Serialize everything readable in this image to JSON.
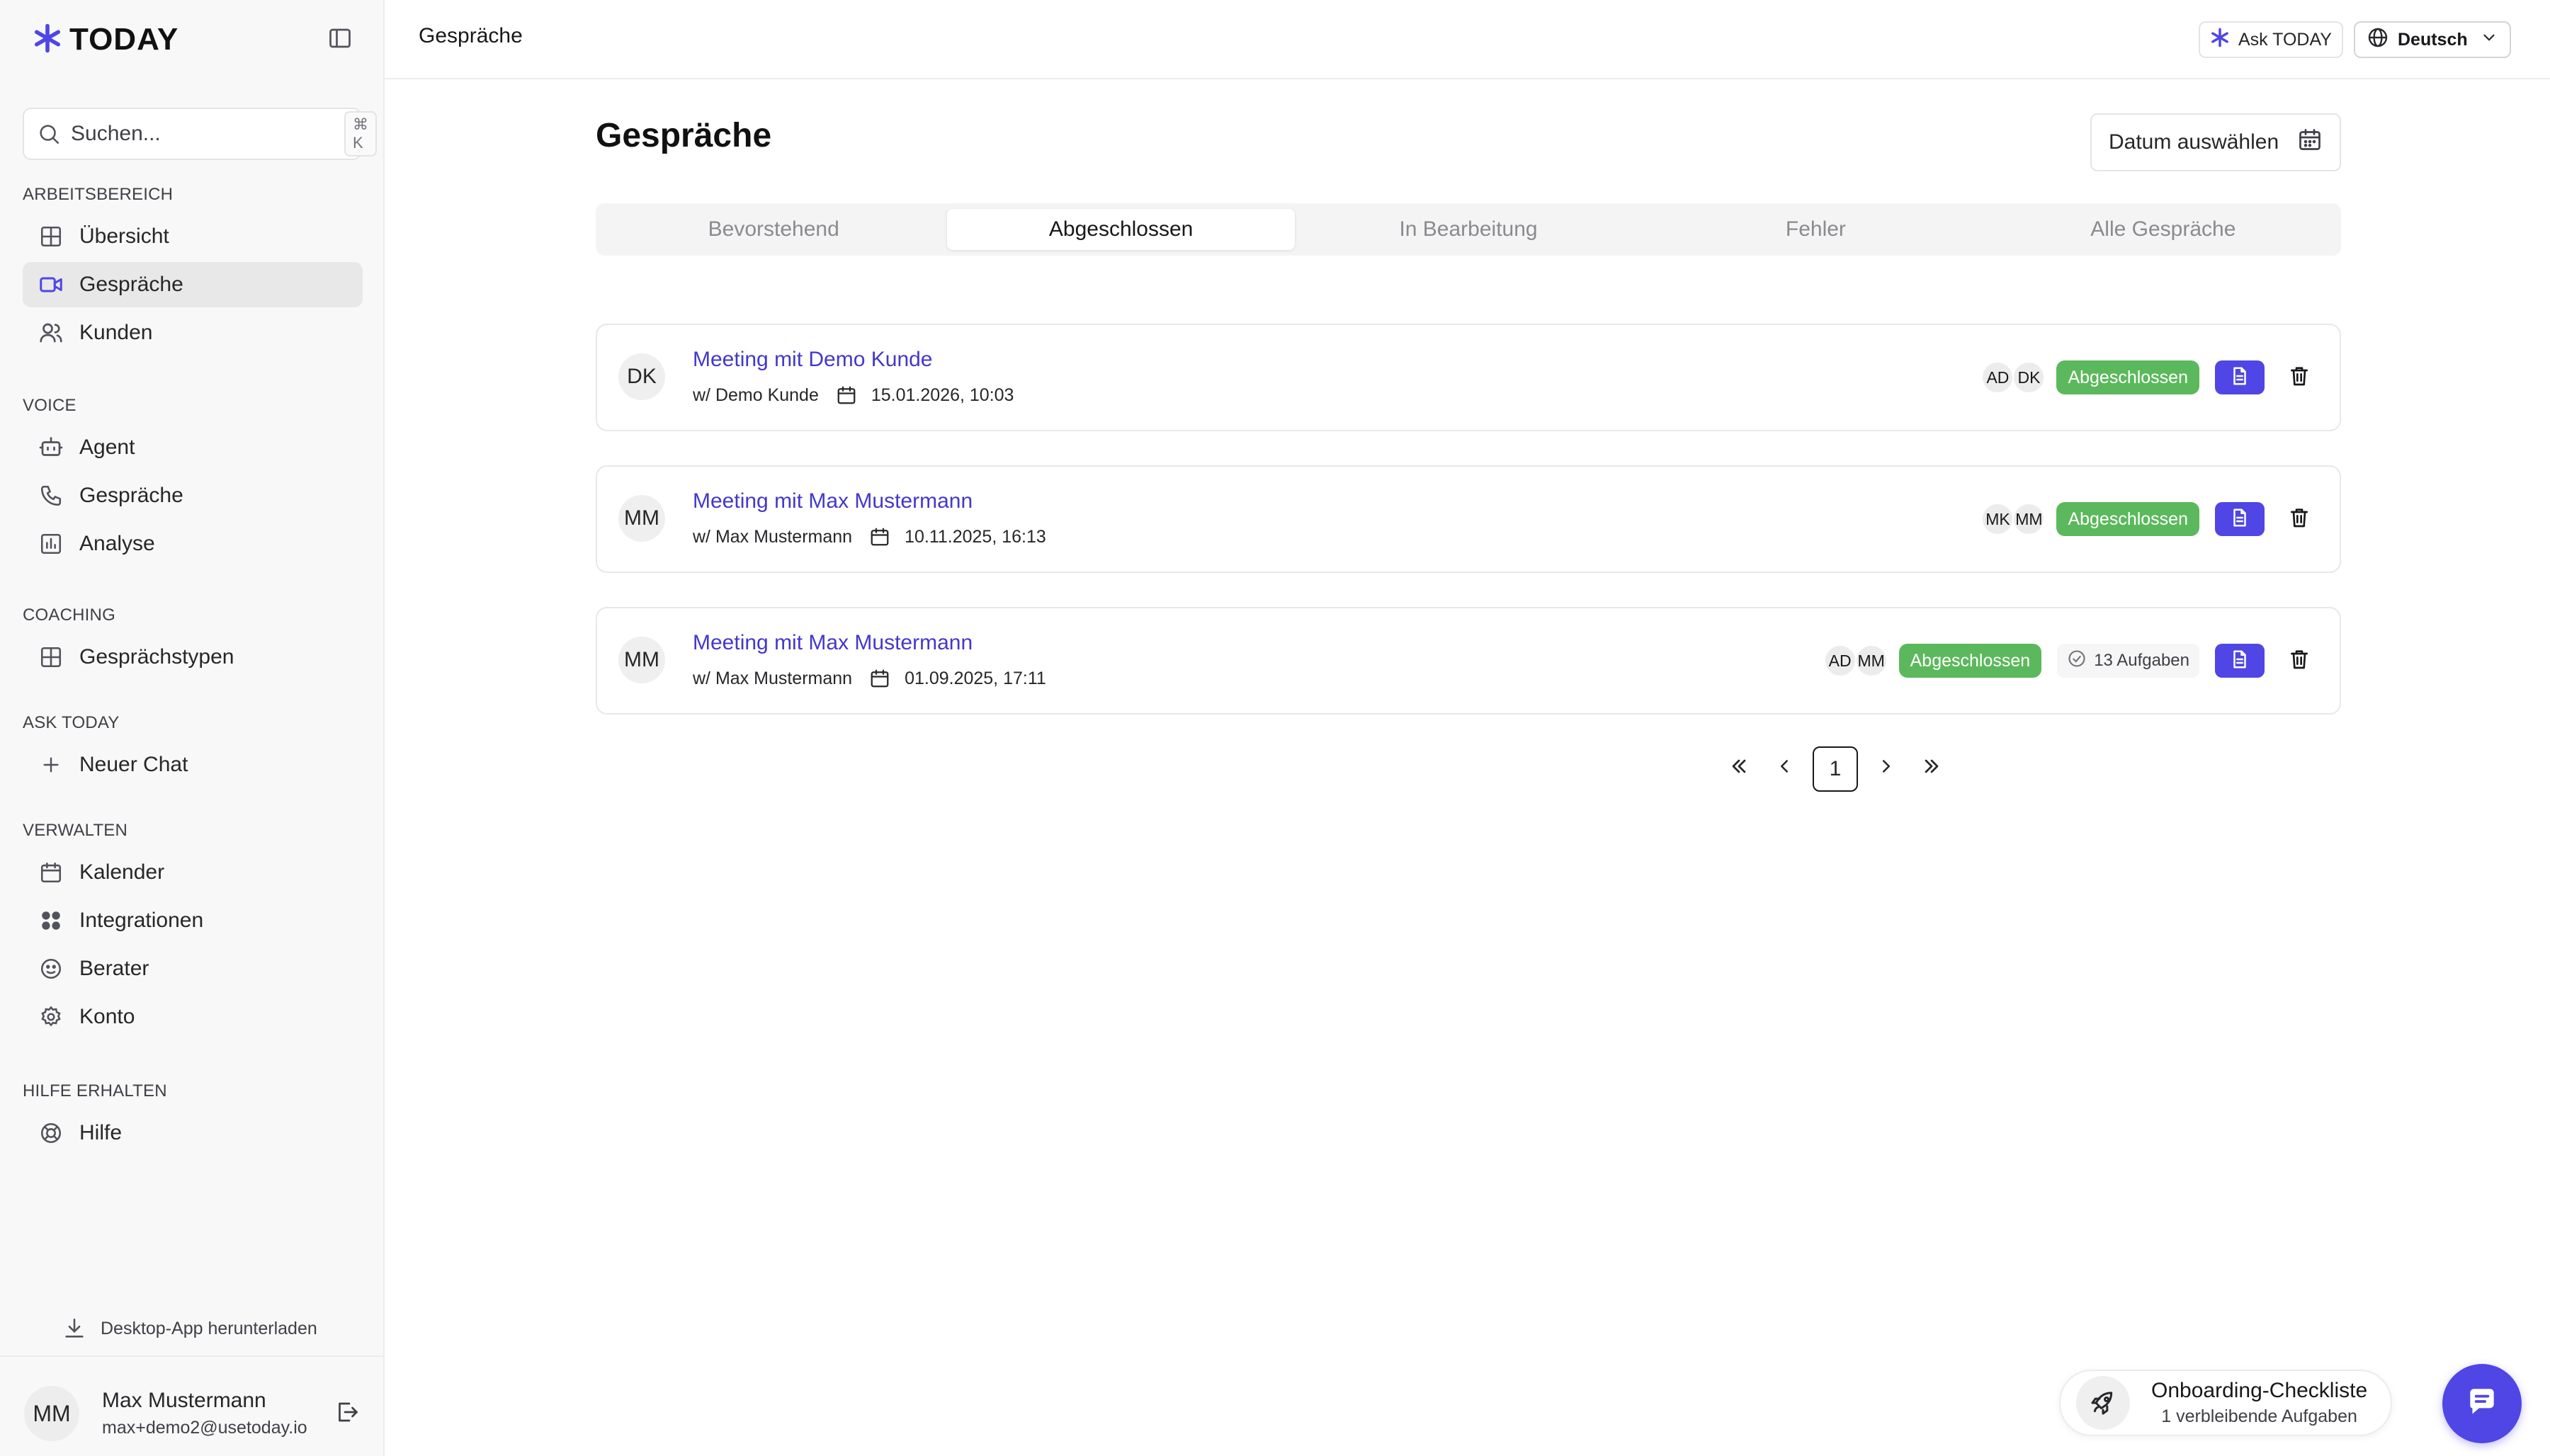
{
  "app": {
    "brand": "TODAY",
    "accent": "#4f46e5"
  },
  "sidebar": {
    "search": {
      "placeholder": "Suchen...",
      "shortcut": "⌘ K"
    },
    "sections": [
      {
        "title": "ARBEITSBEREICH",
        "items": [
          {
            "label": "Übersicht",
            "icon": "grid-icon"
          },
          {
            "label": "Gespräche",
            "icon": "video-icon",
            "active": true
          },
          {
            "label": "Kunden",
            "icon": "users-icon"
          }
        ]
      },
      {
        "title": "VOICE",
        "items": [
          {
            "label": "Agent",
            "icon": "bot-icon"
          },
          {
            "label": "Gespräche",
            "icon": "phone-icon"
          },
          {
            "label": "Analyse",
            "icon": "chart-icon"
          }
        ]
      },
      {
        "title": "COACHING",
        "items": [
          {
            "label": "Gesprächstypen",
            "icon": "grid-icon"
          }
        ]
      },
      {
        "title": "ASK TODAY",
        "items": [
          {
            "label": "Neuer Chat",
            "icon": "plus-icon"
          }
        ]
      },
      {
        "title": "VERWALTEN",
        "items": [
          {
            "label": "Kalender",
            "icon": "calendar-icon"
          },
          {
            "label": "Integrationen",
            "icon": "apps-icon"
          },
          {
            "label": "Berater",
            "icon": "face-icon"
          },
          {
            "label": "Konto",
            "icon": "gear-icon"
          }
        ]
      },
      {
        "title": "HILFE ERHALTEN",
        "items": [
          {
            "label": "Hilfe",
            "icon": "lifebuoy-icon"
          }
        ]
      }
    ],
    "download_label": "Desktop-App herunterladen",
    "user": {
      "initials": "MM",
      "name": "Max Mustermann",
      "email": "max+demo2@usetoday.io"
    }
  },
  "header": {
    "breadcrumb": "Gespräche",
    "ask_label": "Ask TODAY",
    "language": "Deutsch"
  },
  "main": {
    "title": "Gespräche",
    "date_placeholder": "Datum auswählen",
    "tabs": [
      {
        "label": "Bevorstehend"
      },
      {
        "label": "Abgeschlossen",
        "active": true
      },
      {
        "label": "In Bearbeitung"
      },
      {
        "label": "Fehler"
      },
      {
        "label": "Alle Gespräche"
      }
    ],
    "conversations": [
      {
        "initials": "DK",
        "title": "Meeting mit Demo Kunde",
        "with": "w/ Demo Kunde",
        "datetime": "15.01.2026, 10:03",
        "participants": [
          "AD",
          "DK"
        ],
        "status": "Abgeschlossen",
        "tasks": null
      },
      {
        "initials": "MM",
        "title": "Meeting mit Max Mustermann",
        "with": "w/ Max Mustermann",
        "datetime": "10.11.2025, 16:13",
        "participants": [
          "MK",
          "MM"
        ],
        "status": "Abgeschlossen",
        "tasks": null
      },
      {
        "initials": "MM",
        "title": "Meeting mit Max Mustermann",
        "with": "w/ Max Mustermann",
        "datetime": "01.09.2025, 17:11",
        "participants": [
          "AD",
          "MM"
        ],
        "status": "Abgeschlossen",
        "tasks": "13 Aufgaben"
      }
    ],
    "pagination": {
      "current": "1"
    }
  },
  "onboarding": {
    "title": "Onboarding-Checkliste",
    "subtitle": "1 verbleibende Aufgaben"
  },
  "colors": {
    "status_done": "#5cb85c",
    "link": "#4338ca",
    "accent": "#4f46e5"
  }
}
